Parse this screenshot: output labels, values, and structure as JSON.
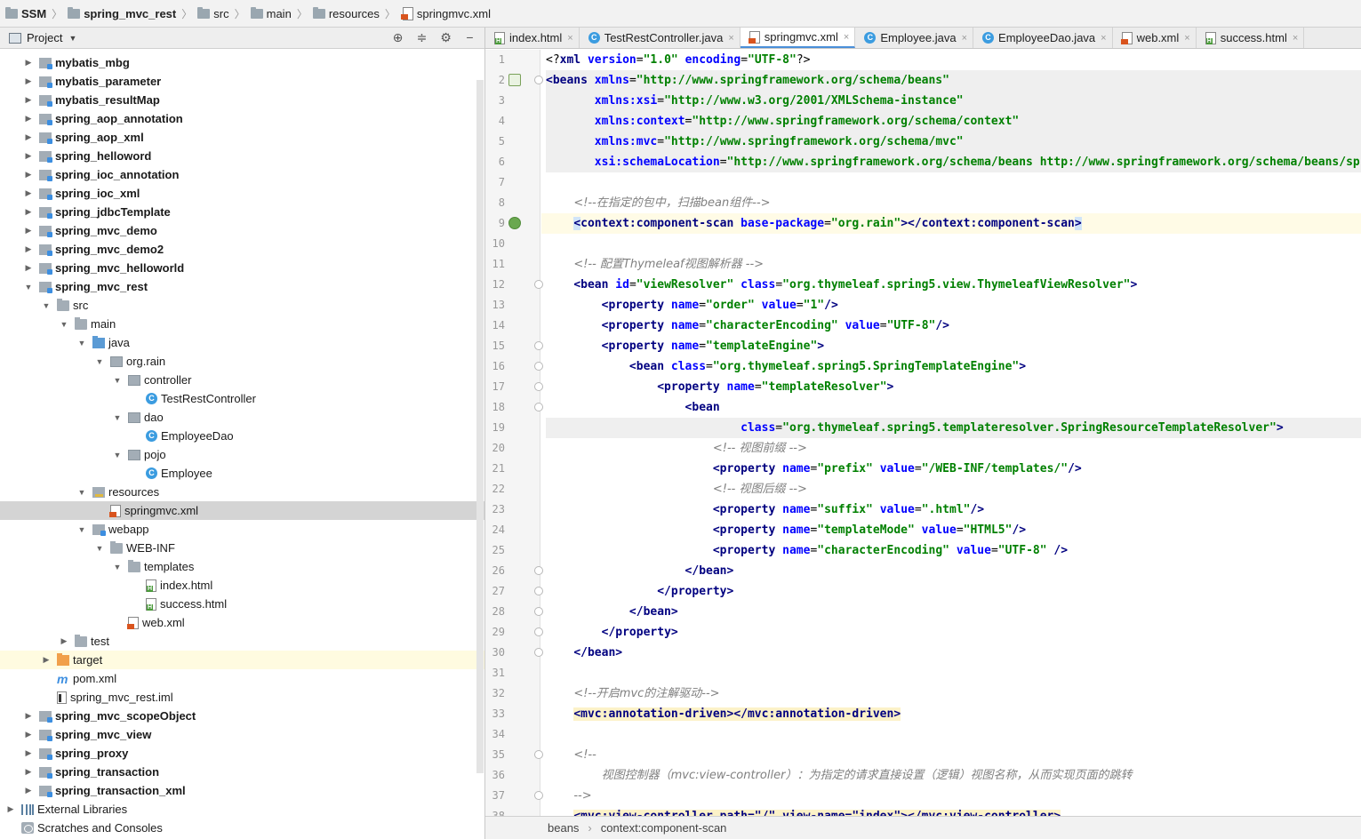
{
  "breadcrumb": [
    {
      "label": "SSM",
      "bold": true,
      "icon": "folder-icon"
    },
    {
      "label": "spring_mvc_rest",
      "bold": true,
      "icon": "folder-icon"
    },
    {
      "label": "src",
      "bold": false,
      "icon": "folder-icon"
    },
    {
      "label": "main",
      "bold": false,
      "icon": "folder-icon"
    },
    {
      "label": "resources",
      "bold": false,
      "icon": "folder-icon"
    },
    {
      "label": "springmvc.xml",
      "bold": false,
      "icon": "xml-file-icon"
    }
  ],
  "project_panel": {
    "title": "Project",
    "tools": [
      "target-icon",
      "collapse-icon",
      "gear-icon",
      "minimize-icon"
    ]
  },
  "tree": [
    {
      "label": "mybatis_mbg",
      "depth": 1,
      "arrow": "▶",
      "icon": "modfolder",
      "bold": true
    },
    {
      "label": "mybatis_parameter",
      "depth": 1,
      "arrow": "▶",
      "icon": "modfolder",
      "bold": true
    },
    {
      "label": "mybatis_resultMap",
      "depth": 1,
      "arrow": "▶",
      "icon": "modfolder",
      "bold": true
    },
    {
      "label": "spring_aop_annotation",
      "depth": 1,
      "arrow": "▶",
      "icon": "modfolder",
      "bold": true
    },
    {
      "label": "spring_aop_xml",
      "depth": 1,
      "arrow": "▶",
      "icon": "modfolder",
      "bold": true
    },
    {
      "label": "spring_helloword",
      "depth": 1,
      "arrow": "▶",
      "icon": "modfolder",
      "bold": true
    },
    {
      "label": "spring_ioc_annotation",
      "depth": 1,
      "arrow": "▶",
      "icon": "modfolder",
      "bold": true
    },
    {
      "label": "spring_ioc_xml",
      "depth": 1,
      "arrow": "▶",
      "icon": "modfolder",
      "bold": true
    },
    {
      "label": "spring_jdbcTemplate",
      "depth": 1,
      "arrow": "▶",
      "icon": "modfolder",
      "bold": true
    },
    {
      "label": "spring_mvc_demo",
      "depth": 1,
      "arrow": "▶",
      "icon": "modfolder",
      "bold": true
    },
    {
      "label": "spring_mvc_demo2",
      "depth": 1,
      "arrow": "▶",
      "icon": "modfolder",
      "bold": true
    },
    {
      "label": "spring_mvc_helloworld",
      "depth": 1,
      "arrow": "▶",
      "icon": "modfolder",
      "bold": true
    },
    {
      "label": "spring_mvc_rest",
      "depth": 1,
      "arrow": "▼",
      "icon": "modfolder",
      "bold": true
    },
    {
      "label": "src",
      "depth": 2,
      "arrow": "▼",
      "icon": "folder",
      "bold": false
    },
    {
      "label": "main",
      "depth": 3,
      "arrow": "▼",
      "icon": "folder",
      "bold": false
    },
    {
      "label": "java",
      "depth": 4,
      "arrow": "▼",
      "icon": "srcfolder",
      "bold": false
    },
    {
      "label": "org.rain",
      "depth": 5,
      "arrow": "▼",
      "icon": "pkg",
      "bold": false
    },
    {
      "label": "controller",
      "depth": 6,
      "arrow": "▼",
      "icon": "pkg",
      "bold": false
    },
    {
      "label": "TestRestController",
      "depth": 7,
      "arrow": "",
      "icon": "cls",
      "bold": false
    },
    {
      "label": "dao",
      "depth": 6,
      "arrow": "▼",
      "icon": "pkg",
      "bold": false
    },
    {
      "label": "EmployeeDao",
      "depth": 7,
      "arrow": "",
      "icon": "cls",
      "bold": false
    },
    {
      "label": "pojo",
      "depth": 6,
      "arrow": "▼",
      "icon": "pkg",
      "bold": false
    },
    {
      "label": "Employee",
      "depth": 7,
      "arrow": "",
      "icon": "cls",
      "bold": false
    },
    {
      "label": "resources",
      "depth": 4,
      "arrow": "▼",
      "icon": "resfolder",
      "bold": false
    },
    {
      "label": "springmvc.xml",
      "depth": 5,
      "arrow": "",
      "icon": "xml",
      "bold": false,
      "selected": true
    },
    {
      "label": "webapp",
      "depth": 4,
      "arrow": "▼",
      "icon": "modfolder",
      "bold": false
    },
    {
      "label": "WEB-INF",
      "depth": 5,
      "arrow": "▼",
      "icon": "folder",
      "bold": false
    },
    {
      "label": "templates",
      "depth": 6,
      "arrow": "▼",
      "icon": "folder",
      "bold": false
    },
    {
      "label": "index.html",
      "depth": 7,
      "arrow": "",
      "icon": "html",
      "bold": false
    },
    {
      "label": "success.html",
      "depth": 7,
      "arrow": "",
      "icon": "html",
      "bold": false
    },
    {
      "label": "web.xml",
      "depth": 6,
      "arrow": "",
      "icon": "xml",
      "bold": false
    },
    {
      "label": "test",
      "depth": 3,
      "arrow": "▶",
      "icon": "folder",
      "bold": false
    },
    {
      "label": "target",
      "depth": 2,
      "arrow": "▶",
      "icon": "target",
      "bold": false,
      "highlighted": true
    },
    {
      "label": "pom.xml",
      "depth": 2,
      "arrow": "",
      "icon": "mvn",
      "bold": false,
      "glyph": "m"
    },
    {
      "label": "spring_mvc_rest.iml",
      "depth": 2,
      "arrow": "",
      "icon": "iml",
      "bold": false
    },
    {
      "label": "spring_mvc_scopeObject",
      "depth": 1,
      "arrow": "▶",
      "icon": "modfolder",
      "bold": true
    },
    {
      "label": "spring_mvc_view",
      "depth": 1,
      "arrow": "▶",
      "icon": "modfolder",
      "bold": true
    },
    {
      "label": "spring_proxy",
      "depth": 1,
      "arrow": "▶",
      "icon": "modfolder",
      "bold": true
    },
    {
      "label": "spring_transaction",
      "depth": 1,
      "arrow": "▶",
      "icon": "modfolder",
      "bold": true
    },
    {
      "label": "spring_transaction_xml",
      "depth": 1,
      "arrow": "▶",
      "icon": "modfolder",
      "bold": true
    },
    {
      "label": "External Libraries",
      "depth": 0,
      "arrow": "▶",
      "icon": "lib",
      "bold": false
    },
    {
      "label": "Scratches and Consoles",
      "depth": 0,
      "arrow": "",
      "icon": "scratch",
      "bold": false
    }
  ],
  "tabs": [
    {
      "label": "index.html",
      "icon": "html",
      "active": false
    },
    {
      "label": "TestRestController.java",
      "icon": "cls",
      "active": false
    },
    {
      "label": "springmvc.xml",
      "icon": "xml",
      "active": true
    },
    {
      "label": "Employee.java",
      "icon": "cls",
      "active": false
    },
    {
      "label": "EmployeeDao.java",
      "icon": "cls",
      "active": false
    },
    {
      "label": "web.xml",
      "icon": "xml",
      "active": false
    },
    {
      "label": "success.html",
      "icon": "html",
      "active": false
    }
  ],
  "tab_close": "×",
  "code_lines": [
    {
      "n": "1",
      "segs": [
        [
          "pi",
          "<?"
        ],
        [
          "tag",
          "xml "
        ],
        [
          "attr",
          "version"
        ],
        [
          "pi",
          "="
        ],
        [
          "val",
          "\"1.0\""
        ],
        [
          "pi",
          " "
        ],
        [
          "attr",
          "encoding"
        ],
        [
          "pi",
          "="
        ],
        [
          "val",
          "\"UTF-8\""
        ],
        [
          "pi",
          "?>"
        ]
      ]
    },
    {
      "n": "2",
      "band": true,
      "segs": [
        [
          "tag",
          "<beans "
        ],
        [
          "attr",
          "xmlns"
        ],
        [
          "pi",
          "="
        ],
        [
          "val",
          "\"http://www.springframework.org/schema/beans\""
        ]
      ]
    },
    {
      "n": "3",
      "band": true,
      "segs": [
        [
          "pi",
          "       "
        ],
        [
          "attr",
          "xmlns:xsi"
        ],
        [
          "pi",
          "="
        ],
        [
          "val",
          "\"http://www.w3.org/2001/XMLSchema-instance\""
        ]
      ]
    },
    {
      "n": "4",
      "band": true,
      "segs": [
        [
          "pi",
          "       "
        ],
        [
          "attr",
          "xmlns:context"
        ],
        [
          "pi",
          "="
        ],
        [
          "val",
          "\"http://www.springframework.org/schema/context\""
        ]
      ]
    },
    {
      "n": "5",
      "band": true,
      "segs": [
        [
          "pi",
          "       "
        ],
        [
          "attr",
          "xmlns:mvc"
        ],
        [
          "pi",
          "="
        ],
        [
          "val",
          "\"http://www.springframework.org/schema/mvc\""
        ]
      ]
    },
    {
      "n": "6",
      "band": true,
      "segs": [
        [
          "pi",
          "       "
        ],
        [
          "attr",
          "xsi:schemaLocation"
        ],
        [
          "pi",
          "="
        ],
        [
          "val",
          "\"http://www.springframework.org/schema/beans http://www.springframework.org/schema/beans/spring-beans.xsd"
        ]
      ]
    },
    {
      "n": "7",
      "segs": []
    },
    {
      "n": "8",
      "segs": [
        [
          "pi",
          "    "
        ],
        [
          "cmt",
          "<!--在指定的包中，扫描bean组件-->"
        ]
      ]
    },
    {
      "n": "9",
      "cur": true,
      "segs": [
        [
          "pi",
          "    "
        ],
        [
          "taghl",
          "<"
        ],
        [
          "tag",
          "context:component-scan "
        ],
        [
          "attr",
          "base-package"
        ],
        [
          "pi",
          "="
        ],
        [
          "val",
          "\"org.rain\""
        ],
        [
          "tag",
          "></context:component-scan"
        ],
        [
          "taghl",
          ">"
        ]
      ]
    },
    {
      "n": "10",
      "segs": []
    },
    {
      "n": "11",
      "segs": [
        [
          "pi",
          "    "
        ],
        [
          "cmt",
          "<!-- 配置Thymeleaf视图解析器 -->"
        ]
      ]
    },
    {
      "n": "12",
      "segs": [
        [
          "pi",
          "    "
        ],
        [
          "tag",
          "<bean "
        ],
        [
          "attr",
          "id"
        ],
        [
          "pi",
          "="
        ],
        [
          "val",
          "\"viewResolver\""
        ],
        [
          "pi",
          " "
        ],
        [
          "attr",
          "class"
        ],
        [
          "pi",
          "="
        ],
        [
          "val",
          "\"org.thymeleaf.spring5.view.ThymeleafViewResolver\""
        ],
        [
          "tag",
          ">"
        ]
      ]
    },
    {
      "n": "13",
      "segs": [
        [
          "pi",
          "        "
        ],
        [
          "tag",
          "<property "
        ],
        [
          "attr",
          "name"
        ],
        [
          "pi",
          "="
        ],
        [
          "val",
          "\"order\""
        ],
        [
          "pi",
          " "
        ],
        [
          "attr",
          "value"
        ],
        [
          "pi",
          "="
        ],
        [
          "val",
          "\"1\""
        ],
        [
          "tag",
          "/>"
        ]
      ]
    },
    {
      "n": "14",
      "segs": [
        [
          "pi",
          "        "
        ],
        [
          "tag",
          "<property "
        ],
        [
          "attr",
          "name"
        ],
        [
          "pi",
          "="
        ],
        [
          "val",
          "\"characterEncoding\""
        ],
        [
          "pi",
          " "
        ],
        [
          "attr",
          "value"
        ],
        [
          "pi",
          "="
        ],
        [
          "val",
          "\"UTF-8\""
        ],
        [
          "tag",
          "/>"
        ]
      ]
    },
    {
      "n": "15",
      "segs": [
        [
          "pi",
          "        "
        ],
        [
          "tag",
          "<property "
        ],
        [
          "attr",
          "name"
        ],
        [
          "pi",
          "="
        ],
        [
          "val",
          "\"templateEngine\""
        ],
        [
          "tag",
          ">"
        ]
      ]
    },
    {
      "n": "16",
      "segs": [
        [
          "pi",
          "            "
        ],
        [
          "tag",
          "<bean "
        ],
        [
          "attr",
          "class"
        ],
        [
          "pi",
          "="
        ],
        [
          "val",
          "\"org.thymeleaf.spring5.SpringTemplateEngine\""
        ],
        [
          "tag",
          ">"
        ]
      ]
    },
    {
      "n": "17",
      "segs": [
        [
          "pi",
          "                "
        ],
        [
          "tag",
          "<property "
        ],
        [
          "attr",
          "name"
        ],
        [
          "pi",
          "="
        ],
        [
          "val",
          "\"templateResolver\""
        ],
        [
          "tag",
          ">"
        ]
      ]
    },
    {
      "n": "18",
      "segs": [
        [
          "pi",
          "                    "
        ],
        [
          "tag",
          "<bean"
        ]
      ]
    },
    {
      "n": "19",
      "band": true,
      "segs": [
        [
          "pi",
          "                            "
        ],
        [
          "attr",
          "class"
        ],
        [
          "pi",
          "="
        ],
        [
          "val",
          "\"org.thymeleaf.spring5.templateresolver.SpringResourceTemplateResolver\""
        ],
        [
          "tag",
          ">"
        ]
      ]
    },
    {
      "n": "20",
      "segs": [
        [
          "pi",
          "                        "
        ],
        [
          "cmt",
          "<!-- 视图前缀 -->"
        ]
      ]
    },
    {
      "n": "21",
      "segs": [
        [
          "pi",
          "                        "
        ],
        [
          "tag",
          "<property "
        ],
        [
          "attr",
          "name"
        ],
        [
          "pi",
          "="
        ],
        [
          "val",
          "\"prefix\""
        ],
        [
          "pi",
          " "
        ],
        [
          "attr",
          "value"
        ],
        [
          "pi",
          "="
        ],
        [
          "val",
          "\"/WEB-INF/templates/\""
        ],
        [
          "tag",
          "/>"
        ]
      ]
    },
    {
      "n": "22",
      "segs": [
        [
          "pi",
          "                        "
        ],
        [
          "cmt",
          "<!-- 视图后缀 -->"
        ]
      ]
    },
    {
      "n": "23",
      "segs": [
        [
          "pi",
          "                        "
        ],
        [
          "tag",
          "<property "
        ],
        [
          "attr",
          "name"
        ],
        [
          "pi",
          "="
        ],
        [
          "val",
          "\"suffix\""
        ],
        [
          "pi",
          " "
        ],
        [
          "attr",
          "value"
        ],
        [
          "pi",
          "="
        ],
        [
          "val",
          "\".html\""
        ],
        [
          "tag",
          "/>"
        ]
      ]
    },
    {
      "n": "24",
      "segs": [
        [
          "pi",
          "                        "
        ],
        [
          "tag",
          "<property "
        ],
        [
          "attr",
          "name"
        ],
        [
          "pi",
          "="
        ],
        [
          "val",
          "\"templateMode\""
        ],
        [
          "pi",
          " "
        ],
        [
          "attr",
          "value"
        ],
        [
          "pi",
          "="
        ],
        [
          "val",
          "\"HTML5\""
        ],
        [
          "tag",
          "/>"
        ]
      ]
    },
    {
      "n": "25",
      "segs": [
        [
          "pi",
          "                        "
        ],
        [
          "tag",
          "<property "
        ],
        [
          "attr",
          "name"
        ],
        [
          "pi",
          "="
        ],
        [
          "val",
          "\"characterEncoding\""
        ],
        [
          "pi",
          " "
        ],
        [
          "attr",
          "value"
        ],
        [
          "pi",
          "="
        ],
        [
          "val",
          "\"UTF-8\""
        ],
        [
          "pi",
          " "
        ],
        [
          "tag",
          "/>"
        ]
      ]
    },
    {
      "n": "26",
      "segs": [
        [
          "pi",
          "                    "
        ],
        [
          "tag",
          "</bean>"
        ]
      ]
    },
    {
      "n": "27",
      "segs": [
        [
          "pi",
          "                "
        ],
        [
          "tag",
          "</property>"
        ]
      ]
    },
    {
      "n": "28",
      "segs": [
        [
          "pi",
          "            "
        ],
        [
          "tag",
          "</bean>"
        ]
      ]
    },
    {
      "n": "29",
      "segs": [
        [
          "pi",
          "        "
        ],
        [
          "tag",
          "</property>"
        ]
      ]
    },
    {
      "n": "30",
      "segs": [
        [
          "pi",
          "    "
        ],
        [
          "tag",
          "</bean>"
        ]
      ]
    },
    {
      "n": "31",
      "segs": []
    },
    {
      "n": "32",
      "segs": [
        [
          "pi",
          "    "
        ],
        [
          "cmt",
          "<!--开启mvc的注解驱动-->"
        ]
      ]
    },
    {
      "n": "33",
      "segs": [
        [
          "pi",
          "    "
        ],
        [
          "match",
          "<mvc:annotation-driven></mvc:annotation-driven>"
        ]
      ]
    },
    {
      "n": "34",
      "segs": []
    },
    {
      "n": "35",
      "segs": [
        [
          "pi",
          "    "
        ],
        [
          "cmt",
          "<!--"
        ]
      ]
    },
    {
      "n": "36",
      "segs": [
        [
          "pi",
          "        "
        ],
        [
          "cmt",
          "视图控制器（mvc:view-controller）：为指定的请求直接设置（逻辑）视图名称，从而实现页面的跳转"
        ]
      ]
    },
    {
      "n": "37",
      "segs": [
        [
          "pi",
          "    "
        ],
        [
          "cmt",
          "-->"
        ]
      ]
    },
    {
      "n": "38",
      "segs": [
        [
          "pi",
          "    "
        ],
        [
          "match",
          "<mvc:view-controller path=\"/\" view-name=\"index\"></mvc:view-controller>"
        ]
      ]
    }
  ],
  "status": [
    "beans",
    "context:component-scan"
  ]
}
